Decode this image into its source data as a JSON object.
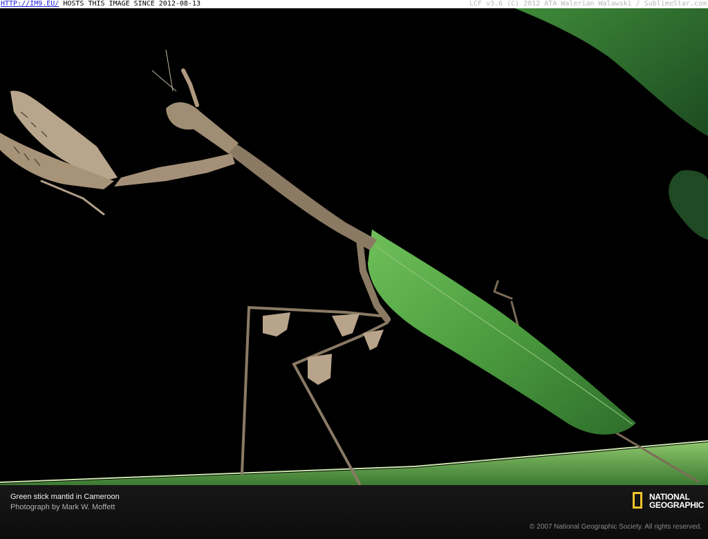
{
  "banner": {
    "link_text": "HTTP://IM9.EU/",
    "host_text": " HOSTS THIS IMAGE SINCE 2012-08-13",
    "credit_text": "LCF v3.6 (C) 2012 ATA Walerian Walawski / SublimeStar.com"
  },
  "photo": {
    "subject": "green stick mantid on a leaf against a black background"
  },
  "caption": {
    "title": "Green stick mantid in Cameroon",
    "photographer": "Photograph by Mark W. Moffett",
    "copyright": "© 2007 National Geographic Society. All rights reserved."
  },
  "logo": {
    "line1": "NATIONAL",
    "line2": "GEOGRAPHIC",
    "frame_color": "#f3c42b"
  },
  "colors": {
    "background": "#000000",
    "leaf_green": "#4e9a3e",
    "mantid_body": "#8a7a62"
  }
}
